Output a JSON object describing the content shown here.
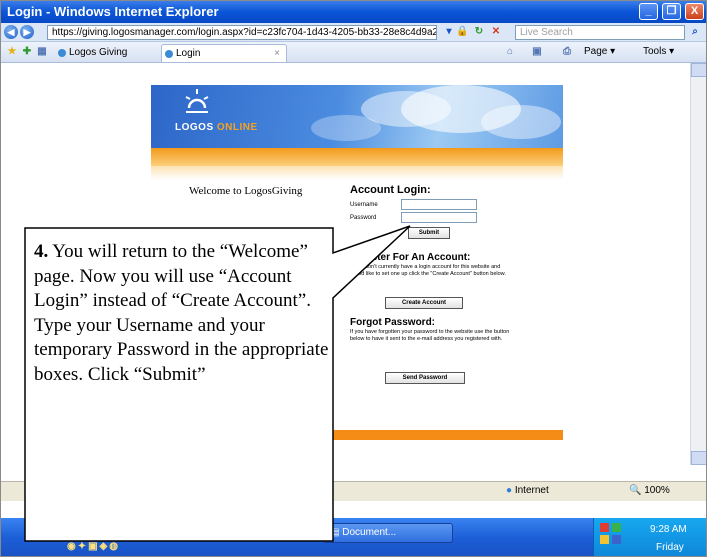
{
  "window": {
    "title": "Login - Windows Internet Explorer",
    "minimize_glyph": "_",
    "maximize_glyph": "❐",
    "close_glyph": "X"
  },
  "addressbar": {
    "url": "https://giving.logosmanager.com/login.aspx?id=c23fc704-1d43-4205-bb33-28e8c4d9a2e",
    "search_placeholder": "Live Search"
  },
  "tabs": [
    {
      "label": "Logos Giving"
    },
    {
      "label": "Login"
    }
  ],
  "toolbar": {
    "page_label": "Page ▾",
    "tools_label": "Tools ▾"
  },
  "page": {
    "logo_text_1": "LOGOS",
    "logo_text_2": "ONLINE",
    "welcome": "Welcome to LogosGiving",
    "account_login": {
      "heading": "Account Login:",
      "username_label": "Username",
      "password_label": "Password",
      "submit_label": "Submit"
    },
    "register": {
      "heading": "Register For An Account:",
      "text": "If you don't currently have a login account for this website and would like to set one up click the \"Create Account\" button below.",
      "button_label": "Create Account"
    },
    "forgot": {
      "heading": "Forgot Password:",
      "text": "If you have forgotten your password to the website use the button below to have it sent to the e-mail address you registered with.",
      "button_label": "Send Password"
    }
  },
  "statusbar": {
    "zone": "Internet",
    "zoom": "100%"
  },
  "taskbar": {
    "document_button": "Document...",
    "time": "9:28 AM",
    "day": "Friday"
  },
  "callout": {
    "step_number": "4.",
    "text": " You will return to the “Welcome” page.  Now you will use “Account Login” instead of “Create Account”.  Type your Username and your temporary Password in the appropriate boxes.  Click “Submit”"
  },
  "colors": {
    "titlebar": "#0a55d8",
    "banner_orange": "#f39a1a",
    "footer_orange": "#f48c16",
    "taskbar": "#1c5ed6"
  }
}
